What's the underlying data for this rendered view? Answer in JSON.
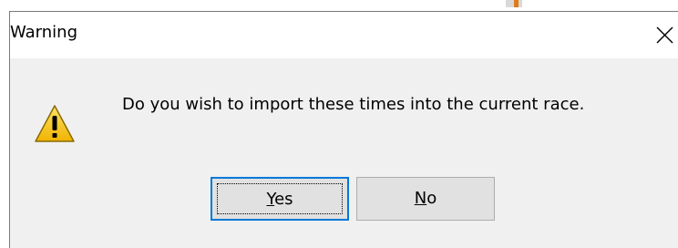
{
  "dialog": {
    "title": "Warning",
    "close_icon": "close-icon",
    "warning_icon": "warning-icon",
    "message": "Do you wish to import these times into the current race.",
    "buttons": {
      "yes": {
        "mnemonic": "Y",
        "rest": "es"
      },
      "no": {
        "mnemonic": "N",
        "rest": "o"
      }
    }
  },
  "colors": {
    "dialog_background": "#f0f0f0",
    "titlebar_background": "#ffffff",
    "default_button_border": "#0078d7",
    "warning_icon_fill": "#f8cd22"
  }
}
